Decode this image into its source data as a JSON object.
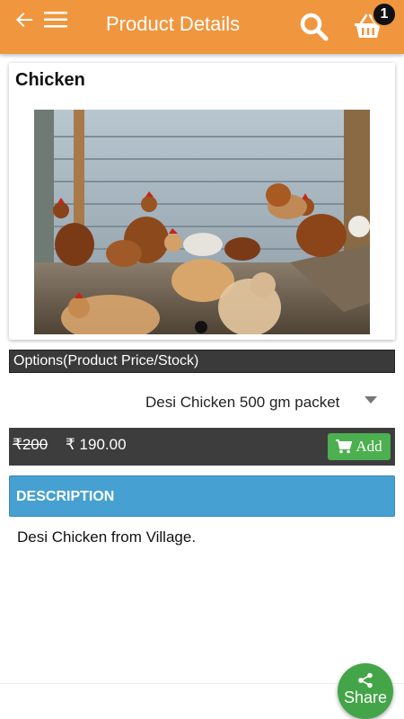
{
  "header": {
    "title": "Product Details",
    "cart_count": "1",
    "icons": [
      "back-arrow-icon",
      "menu-icon",
      "search-icon",
      "cart-icon"
    ]
  },
  "product": {
    "name": "Chicken",
    "image": "chickens-in-coop-photo",
    "carousel_pages": 1
  },
  "options": {
    "label": "Options(Product Price/Stock)",
    "selected": "Desi Chicken 500 gm packet"
  },
  "price": {
    "old": "₹200",
    "new": "₹ 190.00",
    "add_label": "Add"
  },
  "description": {
    "header": "DESCRIPTION",
    "text": "Desi Chicken from Village."
  },
  "share": {
    "label": "Share"
  },
  "colors": {
    "appbar": "#f0963f",
    "description_header": "#46a0d2",
    "add_button": "#4caf50",
    "share_button": "#43a547",
    "dark_bar": "#3d3d3d"
  }
}
